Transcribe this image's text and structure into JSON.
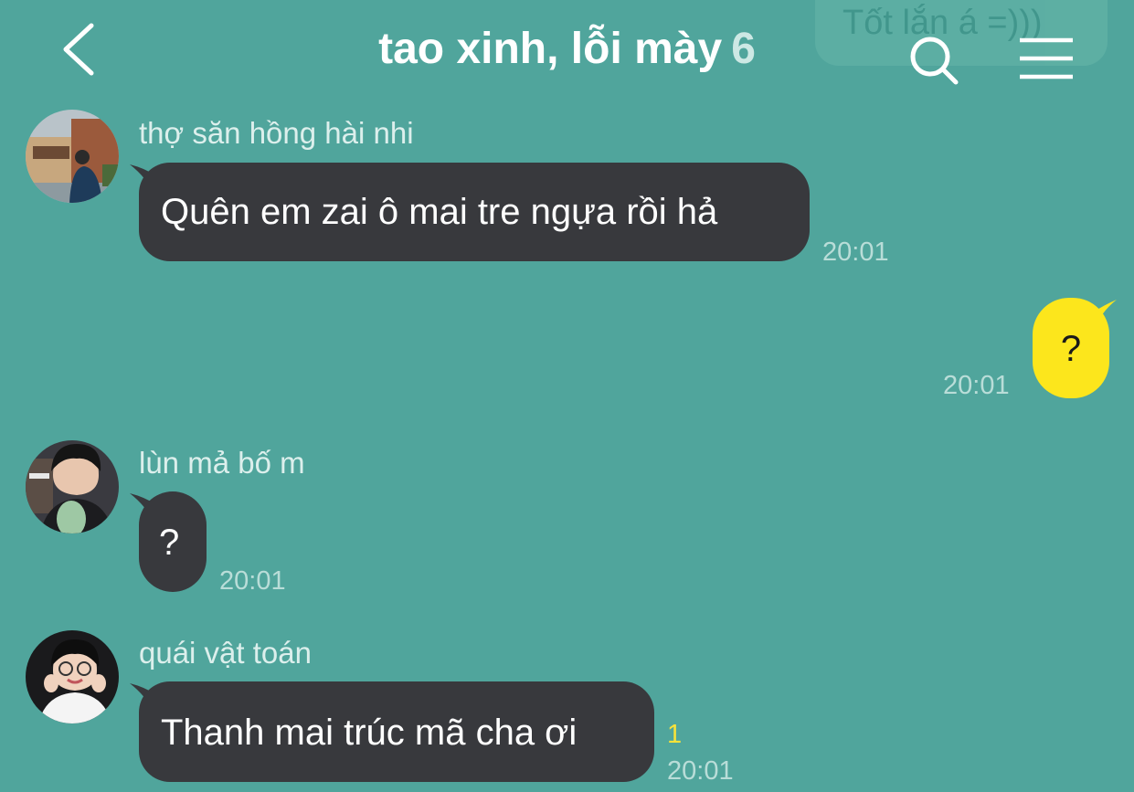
{
  "notification": {
    "preview": "Tốt lắn á =)))"
  },
  "header": {
    "title": "tao xinh, lỗi mày",
    "member_count": "6",
    "back_icon": "chevron-left-icon",
    "search_icon": "search-icon",
    "menu_icon": "hamburger-menu-icon"
  },
  "colors": {
    "background": "#50a59c",
    "incoming_bubble": "#38393d",
    "outgoing_bubble": "#fce61c",
    "unread_count": "#f6e23a"
  },
  "messages": [
    {
      "sender": "thợ săn hồng hài nhi",
      "text": "Quên em zai ô mai tre ngựa rồi hả",
      "time": "20:01",
      "direction": "incoming"
    },
    {
      "sender": "",
      "text": "?",
      "time": "20:01",
      "direction": "outgoing"
    },
    {
      "sender": "lùn mả bố m",
      "text": "?",
      "time": "20:01",
      "direction": "incoming"
    },
    {
      "sender": "quái vật toán",
      "text": "Thanh mai trúc mã cha ơi",
      "time": "20:01",
      "unread": "1",
      "direction": "incoming"
    }
  ]
}
